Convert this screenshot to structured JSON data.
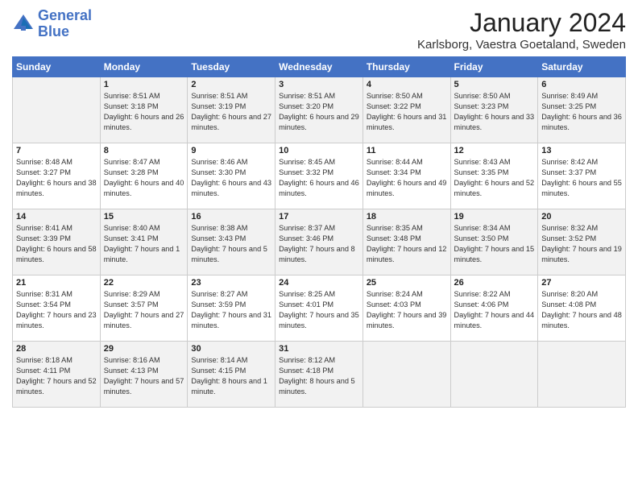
{
  "logo": {
    "line1": "General",
    "line2": "Blue"
  },
  "header": {
    "month": "January 2024",
    "location": "Karlsborg, Vaestra Goetaland, Sweden"
  },
  "weekdays": [
    "Sunday",
    "Monday",
    "Tuesday",
    "Wednesday",
    "Thursday",
    "Friday",
    "Saturday"
  ],
  "weeks": [
    [
      {
        "day": "",
        "sunrise": "",
        "sunset": "",
        "daylight": ""
      },
      {
        "day": "1",
        "sunrise": "Sunrise: 8:51 AM",
        "sunset": "Sunset: 3:18 PM",
        "daylight": "Daylight: 6 hours and 26 minutes."
      },
      {
        "day": "2",
        "sunrise": "Sunrise: 8:51 AM",
        "sunset": "Sunset: 3:19 PM",
        "daylight": "Daylight: 6 hours and 27 minutes."
      },
      {
        "day": "3",
        "sunrise": "Sunrise: 8:51 AM",
        "sunset": "Sunset: 3:20 PM",
        "daylight": "Daylight: 6 hours and 29 minutes."
      },
      {
        "day": "4",
        "sunrise": "Sunrise: 8:50 AM",
        "sunset": "Sunset: 3:22 PM",
        "daylight": "Daylight: 6 hours and 31 minutes."
      },
      {
        "day": "5",
        "sunrise": "Sunrise: 8:50 AM",
        "sunset": "Sunset: 3:23 PM",
        "daylight": "Daylight: 6 hours and 33 minutes."
      },
      {
        "day": "6",
        "sunrise": "Sunrise: 8:49 AM",
        "sunset": "Sunset: 3:25 PM",
        "daylight": "Daylight: 6 hours and 36 minutes."
      }
    ],
    [
      {
        "day": "7",
        "sunrise": "Sunrise: 8:48 AM",
        "sunset": "Sunset: 3:27 PM",
        "daylight": "Daylight: 6 hours and 38 minutes."
      },
      {
        "day": "8",
        "sunrise": "Sunrise: 8:47 AM",
        "sunset": "Sunset: 3:28 PM",
        "daylight": "Daylight: 6 hours and 40 minutes."
      },
      {
        "day": "9",
        "sunrise": "Sunrise: 8:46 AM",
        "sunset": "Sunset: 3:30 PM",
        "daylight": "Daylight: 6 hours and 43 minutes."
      },
      {
        "day": "10",
        "sunrise": "Sunrise: 8:45 AM",
        "sunset": "Sunset: 3:32 PM",
        "daylight": "Daylight: 6 hours and 46 minutes."
      },
      {
        "day": "11",
        "sunrise": "Sunrise: 8:44 AM",
        "sunset": "Sunset: 3:34 PM",
        "daylight": "Daylight: 6 hours and 49 minutes."
      },
      {
        "day": "12",
        "sunrise": "Sunrise: 8:43 AM",
        "sunset": "Sunset: 3:35 PM",
        "daylight": "Daylight: 6 hours and 52 minutes."
      },
      {
        "day": "13",
        "sunrise": "Sunrise: 8:42 AM",
        "sunset": "Sunset: 3:37 PM",
        "daylight": "Daylight: 6 hours and 55 minutes."
      }
    ],
    [
      {
        "day": "14",
        "sunrise": "Sunrise: 8:41 AM",
        "sunset": "Sunset: 3:39 PM",
        "daylight": "Daylight: 6 hours and 58 minutes."
      },
      {
        "day": "15",
        "sunrise": "Sunrise: 8:40 AM",
        "sunset": "Sunset: 3:41 PM",
        "daylight": "Daylight: 7 hours and 1 minute."
      },
      {
        "day": "16",
        "sunrise": "Sunrise: 8:38 AM",
        "sunset": "Sunset: 3:43 PM",
        "daylight": "Daylight: 7 hours and 5 minutes."
      },
      {
        "day": "17",
        "sunrise": "Sunrise: 8:37 AM",
        "sunset": "Sunset: 3:46 PM",
        "daylight": "Daylight: 7 hours and 8 minutes."
      },
      {
        "day": "18",
        "sunrise": "Sunrise: 8:35 AM",
        "sunset": "Sunset: 3:48 PM",
        "daylight": "Daylight: 7 hours and 12 minutes."
      },
      {
        "day": "19",
        "sunrise": "Sunrise: 8:34 AM",
        "sunset": "Sunset: 3:50 PM",
        "daylight": "Daylight: 7 hours and 15 minutes."
      },
      {
        "day": "20",
        "sunrise": "Sunrise: 8:32 AM",
        "sunset": "Sunset: 3:52 PM",
        "daylight": "Daylight: 7 hours and 19 minutes."
      }
    ],
    [
      {
        "day": "21",
        "sunrise": "Sunrise: 8:31 AM",
        "sunset": "Sunset: 3:54 PM",
        "daylight": "Daylight: 7 hours and 23 minutes."
      },
      {
        "day": "22",
        "sunrise": "Sunrise: 8:29 AM",
        "sunset": "Sunset: 3:57 PM",
        "daylight": "Daylight: 7 hours and 27 minutes."
      },
      {
        "day": "23",
        "sunrise": "Sunrise: 8:27 AM",
        "sunset": "Sunset: 3:59 PM",
        "daylight": "Daylight: 7 hours and 31 minutes."
      },
      {
        "day": "24",
        "sunrise": "Sunrise: 8:25 AM",
        "sunset": "Sunset: 4:01 PM",
        "daylight": "Daylight: 7 hours and 35 minutes."
      },
      {
        "day": "25",
        "sunrise": "Sunrise: 8:24 AM",
        "sunset": "Sunset: 4:03 PM",
        "daylight": "Daylight: 7 hours and 39 minutes."
      },
      {
        "day": "26",
        "sunrise": "Sunrise: 8:22 AM",
        "sunset": "Sunset: 4:06 PM",
        "daylight": "Daylight: 7 hours and 44 minutes."
      },
      {
        "day": "27",
        "sunrise": "Sunrise: 8:20 AM",
        "sunset": "Sunset: 4:08 PM",
        "daylight": "Daylight: 7 hours and 48 minutes."
      }
    ],
    [
      {
        "day": "28",
        "sunrise": "Sunrise: 8:18 AM",
        "sunset": "Sunset: 4:11 PM",
        "daylight": "Daylight: 7 hours and 52 minutes."
      },
      {
        "day": "29",
        "sunrise": "Sunrise: 8:16 AM",
        "sunset": "Sunset: 4:13 PM",
        "daylight": "Daylight: 7 hours and 57 minutes."
      },
      {
        "day": "30",
        "sunrise": "Sunrise: 8:14 AM",
        "sunset": "Sunset: 4:15 PM",
        "daylight": "Daylight: 8 hours and 1 minute."
      },
      {
        "day": "31",
        "sunrise": "Sunrise: 8:12 AM",
        "sunset": "Sunset: 4:18 PM",
        "daylight": "Daylight: 8 hours and 5 minutes."
      },
      {
        "day": "",
        "sunrise": "",
        "sunset": "",
        "daylight": ""
      },
      {
        "day": "",
        "sunrise": "",
        "sunset": "",
        "daylight": ""
      },
      {
        "day": "",
        "sunrise": "",
        "sunset": "",
        "daylight": ""
      }
    ]
  ]
}
